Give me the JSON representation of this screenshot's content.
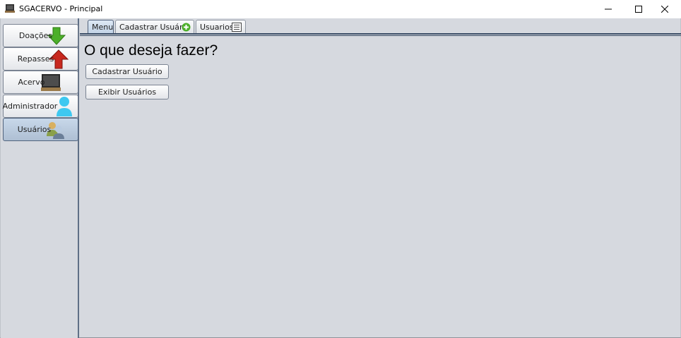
{
  "window": {
    "title": "SGACERVO - Principal",
    "icons": {
      "app": "monitor-icon",
      "minimize": "minimize-icon",
      "maximize": "maximize-icon",
      "close": "close-icon"
    }
  },
  "sidebar": {
    "items": [
      {
        "label": "Doações",
        "icon": "green-down-arrow-icon"
      },
      {
        "label": "Repasses",
        "icon": "red-up-arrow-icon"
      },
      {
        "label": "Acervo",
        "icon": "monitor-icon"
      },
      {
        "label": "Administrador",
        "icon": "user-icon"
      },
      {
        "label": "Usuários",
        "icon": "users-icon",
        "selected": true
      }
    ]
  },
  "tabs": [
    {
      "label": "Menu",
      "active": true
    },
    {
      "label": "Cadastrar Usuário",
      "icon": "plus-circle-icon"
    },
    {
      "label": "Usuarios",
      "icon": "list-icon"
    }
  ],
  "main": {
    "heading": "O que deseja fazer?",
    "buttons": [
      {
        "label": "Cadastrar Usuário"
      },
      {
        "label": "Exibir Usuários"
      }
    ]
  },
  "colors": {
    "background": "#d6d9df",
    "selected": "#aebfd3",
    "accent_border": "#3a4d66",
    "green_icon": "#4caf2a",
    "red_icon": "#c8281e",
    "user_icon": "#3ec8f0"
  }
}
